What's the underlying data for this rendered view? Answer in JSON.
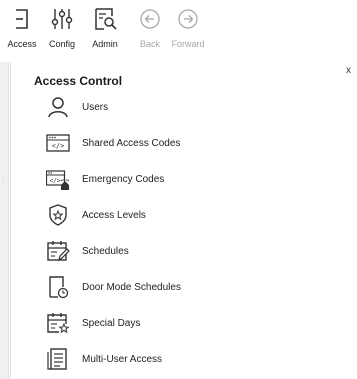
{
  "toolbar": {
    "access": {
      "label": "Access",
      "icon": "exit-door-icon"
    },
    "config": {
      "label": "Config",
      "icon": "sliders-icon"
    },
    "admin": {
      "label": "Admin",
      "icon": "admin-search-icon"
    },
    "back": {
      "label": "Back",
      "icon": "back-arrow-circle-icon",
      "enabled": false
    },
    "forward": {
      "label": "Forward",
      "icon": "forward-arrow-circle-icon",
      "enabled": false
    }
  },
  "panel": {
    "title": "Access Control",
    "close_label": "x",
    "items": [
      {
        "label": "Users",
        "icon": "user-icon"
      },
      {
        "label": "Shared Access Codes",
        "icon": "code-keypad-icon"
      },
      {
        "label": "Emergency Codes",
        "icon": "emergency-code-icon"
      },
      {
        "label": "Access Levels",
        "icon": "shield-star-icon"
      },
      {
        "label": "Schedules",
        "icon": "calendar-edit-icon"
      },
      {
        "label": "Door Mode Schedules",
        "icon": "door-clock-icon"
      },
      {
        "label": "Special Days",
        "icon": "calendar-star-icon"
      },
      {
        "label": "Multi-User Access",
        "icon": "document-list-icon"
      }
    ]
  },
  "colors": {
    "icon": "#333333",
    "disabled": "#a8a8a8",
    "text": "#222222"
  }
}
